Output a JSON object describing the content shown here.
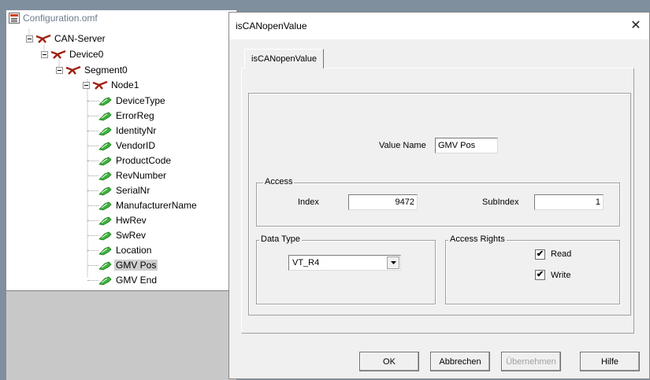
{
  "tree": {
    "title": "Configuration.omf",
    "nodes": [
      {
        "label": "CAN-Server"
      },
      {
        "label": "Device0"
      },
      {
        "label": "Segment0"
      },
      {
        "label": "Node1"
      }
    ],
    "leaves": [
      {
        "label": "DeviceType"
      },
      {
        "label": "ErrorReg"
      },
      {
        "label": "IdentityNr"
      },
      {
        "label": "VendorID"
      },
      {
        "label": "ProductCode"
      },
      {
        "label": "RevNumber"
      },
      {
        "label": "SerialNr"
      },
      {
        "label": "ManufacturerName"
      },
      {
        "label": "HwRev"
      },
      {
        "label": "SwRev"
      },
      {
        "label": "Location"
      },
      {
        "label": "GMV Pos",
        "selected": true
      },
      {
        "label": "GMV End"
      }
    ]
  },
  "dialog": {
    "title": "isCANopenValue",
    "close_icon": "✕",
    "tab_label": "isCANopenValue",
    "value_name_label": "Value Name",
    "value_name": "GMV Pos",
    "access": {
      "group_title": "Access",
      "index_label": "Index",
      "index_value": "9472",
      "subindex_label": "SubIndex",
      "subindex_value": "1"
    },
    "data_type": {
      "group_title": "Data Type",
      "selected": "VT_R4"
    },
    "access_rights": {
      "group_title": "Access Rights",
      "read_label": "Read",
      "read_checked": true,
      "write_label": "Write",
      "write_checked": true
    },
    "buttons": {
      "ok": "OK",
      "cancel": "Abbrechen",
      "apply": "Übernehmen",
      "help": "Hilfe"
    }
  }
}
